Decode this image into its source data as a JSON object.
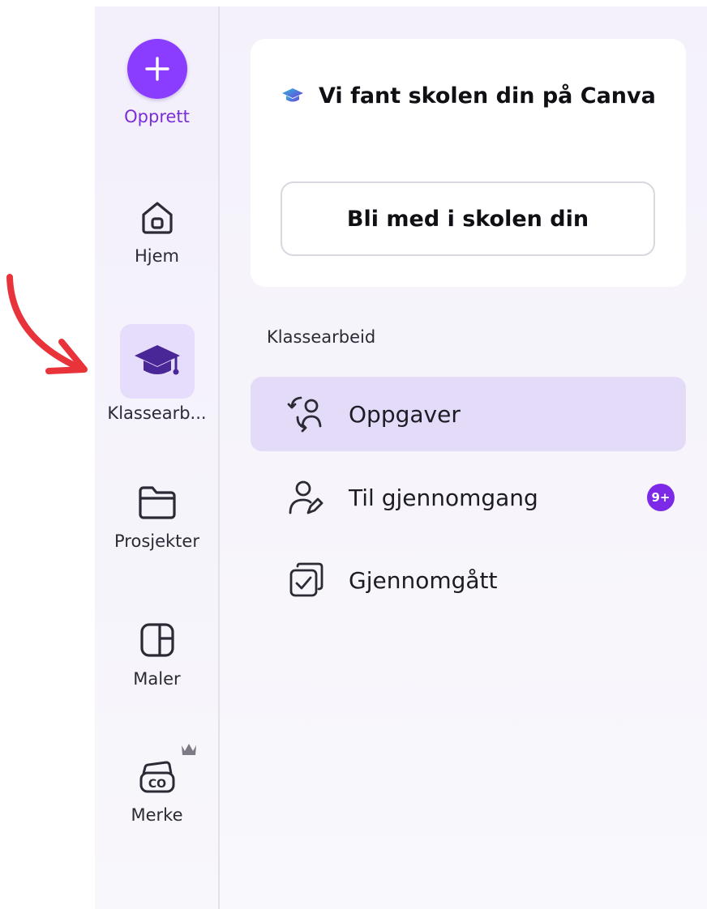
{
  "sidebar": {
    "create_label": "Opprett",
    "items": [
      {
        "label": "Hjem",
        "icon": "home-icon"
      },
      {
        "label": "Klassearb...",
        "icon": "graduation-cap-icon",
        "active": true
      },
      {
        "label": "Prosjekter",
        "icon": "folder-icon"
      },
      {
        "label": "Maler",
        "icon": "template-icon"
      },
      {
        "label": "Merke",
        "icon": "brand-kit-icon",
        "premium_icon": "crown-icon"
      }
    ]
  },
  "school_card": {
    "title": "Vi fant skolen din på Canva",
    "join_button": "Bli med i skolen din"
  },
  "classwork": {
    "heading": "Klassearbeid",
    "items": [
      {
        "label": "Oppgaver",
        "icon": "assignments-icon",
        "active": true
      },
      {
        "label": "Til gjennomgang",
        "icon": "review-icon",
        "badge": "9+"
      },
      {
        "label": "Gjennomgått",
        "icon": "reviewed-icon"
      }
    ]
  },
  "colors": {
    "accent": "#8b3dff",
    "active_bg": "#e4dbf8",
    "badge": "#7d2ae8",
    "annotation_arrow": "#e8333a"
  }
}
